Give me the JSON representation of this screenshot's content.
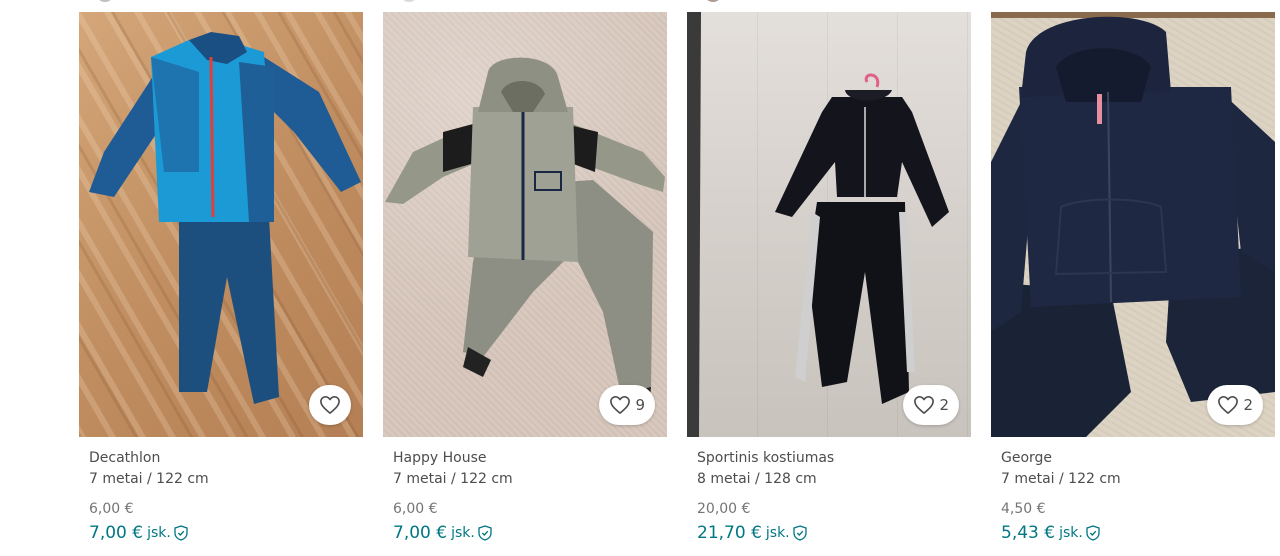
{
  "colors": {
    "accent": "#007782",
    "favorite_bg": "#ffffff"
  },
  "items": [
    {
      "brand": "Decathlon",
      "size": "7 metai / 122 cm",
      "price": "6,00 €",
      "total": "7,00 €",
      "total_suffix": "jsk.",
      "favorites": ""
    },
    {
      "brand": "Happy House",
      "size": "7 metai / 122 cm",
      "price": "6,00 €",
      "total": "7,00 €",
      "total_suffix": "jsk.",
      "favorites": "9"
    },
    {
      "brand": "Sportinis kostiumas",
      "size": "8 metai / 128 cm",
      "price": "20,00 €",
      "total": "21,70 €",
      "total_suffix": "jsk.",
      "favorites": "2"
    },
    {
      "brand": "George",
      "size": "7 metai / 122 cm",
      "price": "4,50 €",
      "total": "5,43 €",
      "total_suffix": "jsk.",
      "favorites": "2"
    }
  ],
  "icons": {
    "favorite": "heart-outline-icon",
    "buyer_protection": "shield-check-icon"
  }
}
